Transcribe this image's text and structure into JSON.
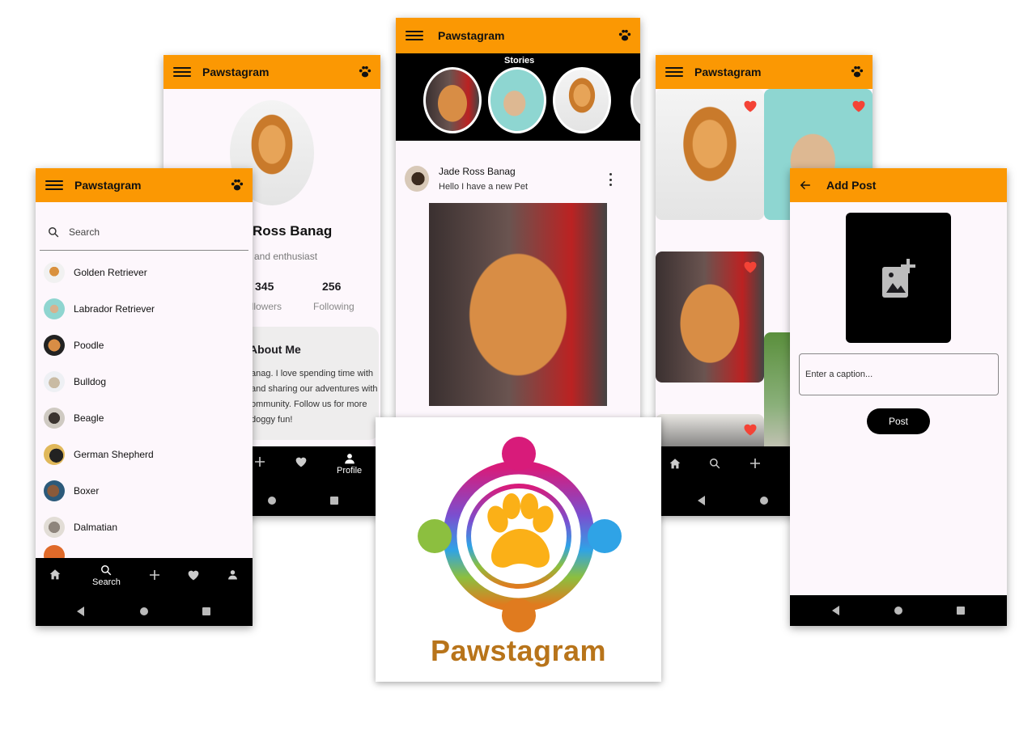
{
  "app_name": "Pawstagram",
  "brand": {
    "accent": "#fb9803",
    "nav_bg": "#000000",
    "screen_bg": "#fdf7fc"
  },
  "search_screen": {
    "title": "Pawstagram",
    "search_placeholder": "Search",
    "breeds": [
      "Golden Retriever",
      "Labrador Retriever",
      "Poodle",
      "Bulldog",
      "Beagle",
      "German Shepherd",
      "Boxer",
      "Dalmatian"
    ],
    "nav": {
      "active_label": "Search",
      "items": [
        "home-icon",
        "search-icon",
        "add-icon",
        "heart-icon",
        "profile-icon"
      ]
    }
  },
  "profile_screen": {
    "title": "Pawstagram",
    "name": "Ross Banag",
    "bio": "er and enthusiast",
    "stats": [
      {
        "value": "345",
        "label": "ollowers"
      },
      {
        "value": "256",
        "label": "Following"
      }
    ],
    "about_title": "About Me",
    "about_text": [
      "anag. I love spending time with",
      "and sharing our adventures with",
      "ommunity. Follow us for more",
      "doggy fun!"
    ],
    "nav": {
      "active_label": "Profile"
    }
  },
  "feed_screen": {
    "title": "Pawstagram",
    "stories_label": "Stories",
    "post": {
      "author": "Jade Ross Banag",
      "caption": "Hello I have a new Pet"
    }
  },
  "favorites_screen": {
    "title": "Pawstagram",
    "heart_color": "#f44336"
  },
  "add_post_screen": {
    "title": "Add Post",
    "caption_placeholder": "Enter a caption...",
    "post_button": "Post"
  },
  "logo": {
    "wordmark": "Pawstagram",
    "colors": {
      "pink": "#d81b7a",
      "green": "#8cbf3f",
      "blue": "#2fa3e6",
      "orange": "#e07b1f",
      "paw": "#fbb017",
      "wordmark": "#b8741a"
    }
  }
}
